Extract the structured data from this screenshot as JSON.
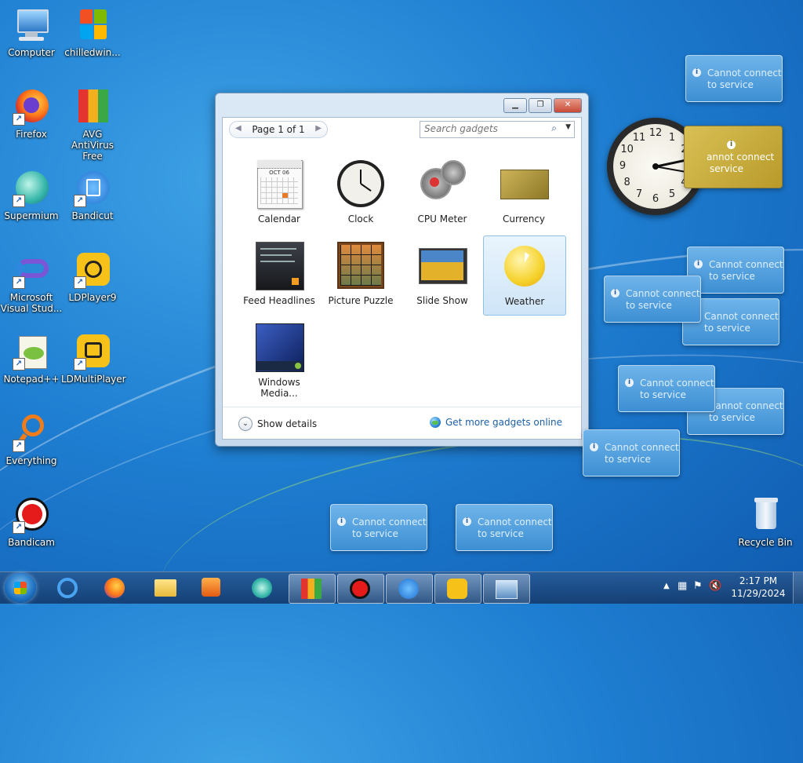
{
  "desktop_icons": [
    {
      "label": "Computer"
    },
    {
      "label": "chilledwin..."
    },
    {
      "label": "Firefox"
    },
    {
      "label": "AVG AntiVirus Free"
    },
    {
      "label": "Supermium"
    },
    {
      "label": "Bandicut"
    },
    {
      "label": "Microsoft Visual Stud..."
    },
    {
      "label": "LDPlayer9"
    },
    {
      "label": "Notepad++"
    },
    {
      "label": "LDMultiPlayer"
    },
    {
      "label": "Everything"
    },
    {
      "label": "Bandicam"
    },
    {
      "label": "Recycle Bin"
    }
  ],
  "gadget_window": {
    "pager": "Page 1 of 1",
    "search_placeholder": "Search gadgets",
    "gadgets": [
      {
        "label": "Calendar"
      },
      {
        "label": "Clock"
      },
      {
        "label": "CPU Meter"
      },
      {
        "label": "Currency"
      },
      {
        "label": "Feed Headlines"
      },
      {
        "label": "Picture Puzzle"
      },
      {
        "label": "Slide Show"
      },
      {
        "label": "Weather"
      },
      {
        "label": "Windows Media..."
      }
    ],
    "show_details": "Show details",
    "get_more": "Get more gadgets online",
    "calendar_month": "OCT 06"
  },
  "info_gadget": {
    "line1": "Cannot connect",
    "line2": "to service"
  },
  "currency_gadget": {
    "line1": "annot connect",
    "line2": "service"
  },
  "clock_numbers": [
    "12",
    "1",
    "2",
    "3",
    "4",
    "5",
    "6",
    "7",
    "8",
    "9",
    "10",
    "11"
  ],
  "taskbar": {
    "time": "2:17 PM",
    "date": "11/29/2024"
  },
  "colors": {
    "accent": "#1f7fd2",
    "info_bg": "#4a9be0",
    "link": "#1b5fa8"
  }
}
